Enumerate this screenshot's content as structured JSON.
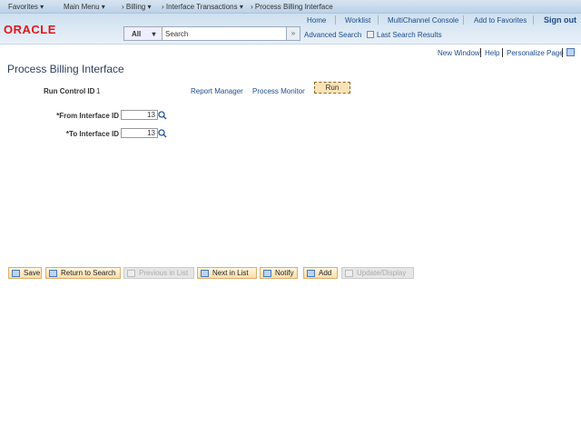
{
  "navbar": {
    "favorites": "Favorites",
    "main_menu": "Main Menu",
    "breadcrumbs": [
      "Billing",
      "Interface Transactions",
      "Process Billing Interface"
    ]
  },
  "header": {
    "logo": "ORACLE",
    "links": [
      "Home",
      "Worklist",
      "MultiChannel Console",
      "Add to Favorites",
      "Sign out"
    ],
    "search_scope": "All",
    "search_placeholder": "Search",
    "advanced_search": "Advanced Search",
    "last_results": "Last Search Results"
  },
  "pagebar": {
    "new_window": "New Window",
    "help": "Help",
    "personalize": "Personalize Page"
  },
  "page": {
    "title": "Process Billing Interface",
    "run_control_label": "Run Control ID",
    "run_control_value": "1",
    "report_manager": "Report Manager",
    "process_monitor": "Process Monitor",
    "run": "Run",
    "from_label": "*From Interface ID",
    "from_value": "13",
    "to_label": "*To Interface ID",
    "to_value": "13"
  },
  "toolbar": {
    "save": "Save",
    "return": "Return to Search",
    "previous": "Previous in List",
    "next": "Next in List",
    "notify": "Notify",
    "add": "Add",
    "update": "Update/Display"
  }
}
